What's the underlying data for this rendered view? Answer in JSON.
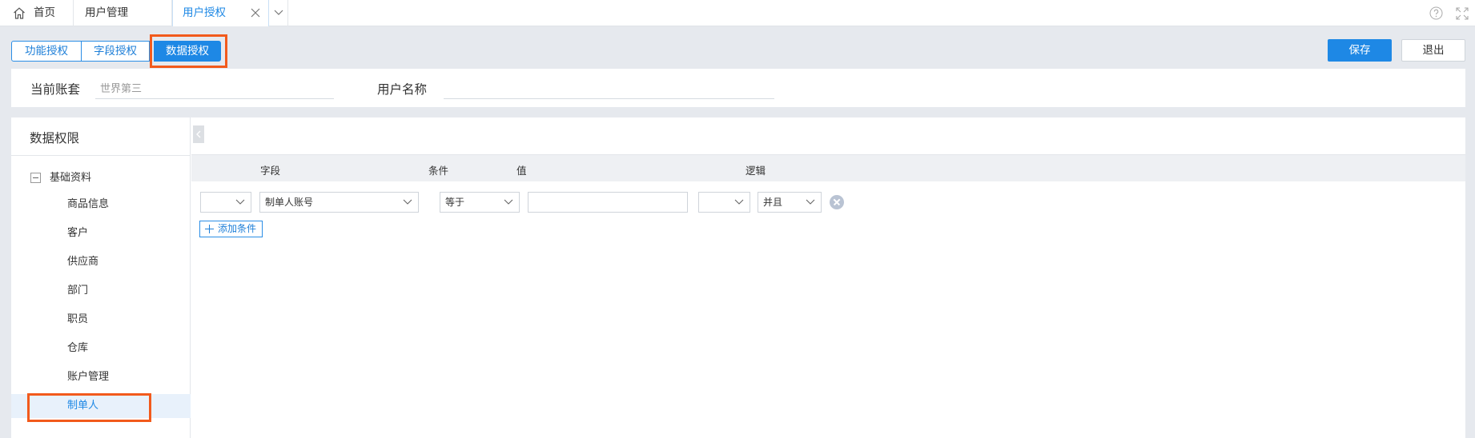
{
  "tabs": {
    "home": "首页",
    "user_mgmt": "用户管理",
    "user_auth": "用户授权"
  },
  "subtabs": [
    "功能授权",
    "字段授权",
    "数据授权"
  ],
  "actions": {
    "save": "保存",
    "exit": "退出"
  },
  "account": {
    "current_label": "当前账套",
    "current_value": "世界第三",
    "username_label": "用户名称",
    "username_value": ""
  },
  "left": {
    "title": "数据权限",
    "root": "基础资料",
    "items": [
      "商品信息",
      "客户",
      "供应商",
      "部门",
      "职员",
      "仓库",
      "账户管理",
      "制单人"
    ]
  },
  "grid": {
    "headers": {
      "field": "字段",
      "condition": "条件",
      "value": "值",
      "logic": "逻辑"
    },
    "row": {
      "field": "制单人账号",
      "condition": "等于",
      "value": "",
      "logic": "并且"
    },
    "add_condition": "添加条件"
  },
  "colors": {
    "accent": "#1e88e5",
    "highlight": "#f25a1c"
  },
  "icons": [
    "home-icon",
    "close-icon",
    "chevron-down-icon",
    "help-icon",
    "fullscreen-icon",
    "chevron-left-icon",
    "remove-icon",
    "plus-icon"
  ]
}
